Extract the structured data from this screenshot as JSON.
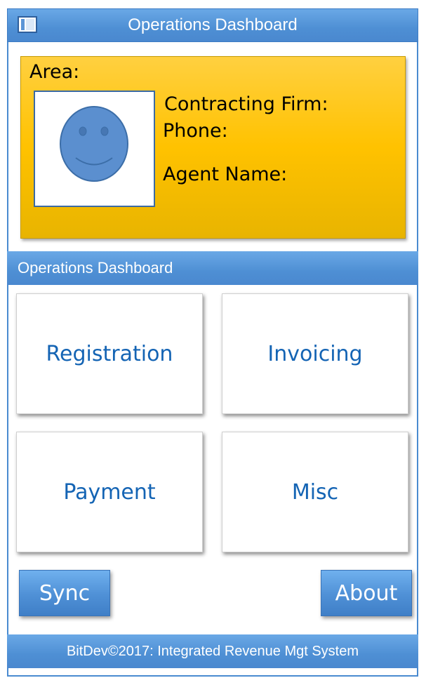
{
  "window": {
    "title": "Operations Dashboard",
    "icon": "window-icon"
  },
  "profile": {
    "area_label": "Area:",
    "contracting_firm_label": "Contracting Firm:",
    "phone_label": "Phone:",
    "agent_name_label": "Agent Name:",
    "avatar_icon": "smiley-face-icon",
    "background_color": "#ffc200"
  },
  "section": {
    "title": "Operations Dashboard"
  },
  "tiles": [
    {
      "label": "Registration"
    },
    {
      "label": "Invoicing"
    },
    {
      "label": "Payment"
    },
    {
      "label": "Misc"
    }
  ],
  "actions": {
    "sync_label": "Sync",
    "about_label": "About"
  },
  "footer": {
    "text": "BitDev©2017: Integrated Revenue Mgt System"
  },
  "colors": {
    "accent": "#4e8fd4",
    "tile_text": "#1464b4"
  }
}
